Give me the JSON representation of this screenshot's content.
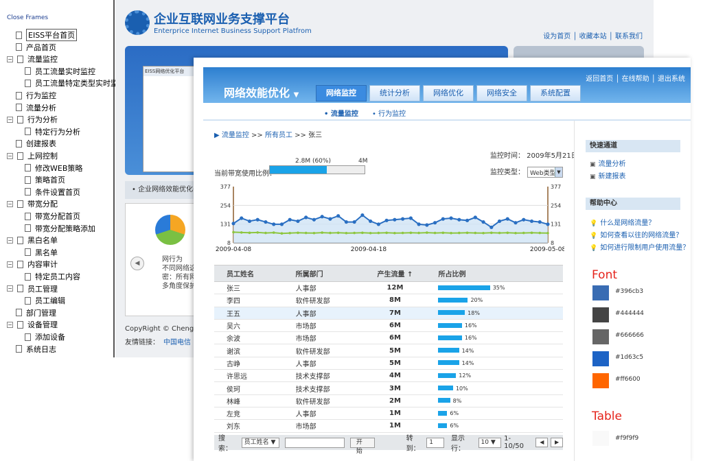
{
  "tree": {
    "close_frames": "Close Frames",
    "items": [
      {
        "label": "EISS平台首页",
        "type": "doc",
        "indent": 1,
        "selected": true
      },
      {
        "label": "产品首页",
        "type": "doc",
        "indent": 1
      },
      {
        "label": "流量监控",
        "type": "folder",
        "indent": 0
      },
      {
        "label": "员工流量实时监控",
        "type": "doc",
        "indent": 2
      },
      {
        "label": "员工流量特定类型实时监",
        "type": "doc",
        "indent": 2
      },
      {
        "label": "行为监控",
        "type": "doc",
        "indent": 1
      },
      {
        "label": "流量分析",
        "type": "doc",
        "indent": 1
      },
      {
        "label": "行为分析",
        "type": "folder",
        "indent": 0
      },
      {
        "label": "特定行为分析",
        "type": "doc",
        "indent": 2
      },
      {
        "label": "创建报表",
        "type": "doc",
        "indent": 1
      },
      {
        "label": "上网控制",
        "type": "folder",
        "indent": 0
      },
      {
        "label": "修改WEB策略",
        "type": "doc",
        "indent": 2
      },
      {
        "label": "策略首页",
        "type": "doc",
        "indent": 2
      },
      {
        "label": "条件设置首页",
        "type": "doc",
        "indent": 2
      },
      {
        "label": "带宽分配",
        "type": "folder",
        "indent": 0
      },
      {
        "label": "带宽分配首页",
        "type": "doc",
        "indent": 2
      },
      {
        "label": "带宽分配策略添加",
        "type": "doc",
        "indent": 2
      },
      {
        "label": "黑白名单",
        "type": "folder",
        "indent": 0
      },
      {
        "label": "黑名单",
        "type": "doc",
        "indent": 2
      },
      {
        "label": "内容审计",
        "type": "folder",
        "indent": 0
      },
      {
        "label": "特定员工内容",
        "type": "doc",
        "indent": 2
      },
      {
        "label": "员工管理",
        "type": "folder",
        "indent": 0
      },
      {
        "label": "员工编辑",
        "type": "doc",
        "indent": 2
      },
      {
        "label": "部门管理",
        "type": "doc",
        "indent": 1
      },
      {
        "label": "设备管理",
        "type": "folder",
        "indent": 0
      },
      {
        "label": "添加设备",
        "type": "doc",
        "indent": 2
      },
      {
        "label": "系统日志",
        "type": "doc",
        "indent": 1
      }
    ]
  },
  "back": {
    "logo_cn": "企业互联网业务支撑平台",
    "logo_en": "Enterprice Internet Business Support Platfrom",
    "toplinks": "设为首页 │ 收藏本站 │ 联系我们",
    "shot_title": "EISS网络优化平台",
    "bar_text": "• 企业网络效能优化平",
    "panel_text": [
      "网行为",
      "不同网络这",
      "密：所有网",
      "多角度保护"
    ],
    "copyright": "CopyRight © Chengdu",
    "links_label": "友情链接：",
    "links_item": "中国电信"
  },
  "front": {
    "title": "网络效能优化",
    "head_links": "返回首页 │ 在线帮助 │ 退出系统",
    "tabs": [
      "网络监控",
      "统计分析",
      "网络优化",
      "网络安全",
      "系统配置"
    ],
    "subnav": [
      "• 流量监控",
      "• 行为监控"
    ],
    "crumb": {
      "a": "▶ 流量监控",
      "sep1": " >> ",
      "b": "所有员工",
      "sep2": " >> ",
      "c": "张三"
    },
    "monitor_time": "监控时间： 2009年5月21日",
    "monitor_type_label": "监控类型：",
    "monitor_type_value": "Web类型",
    "bw_label": "当前带宽使用比例：",
    "bw_used": "2.8M (60%)",
    "bw_total": "4M",
    "bw_fraction": 0.6,
    "table": {
      "headers": [
        "员工姓名",
        "所属部门",
        "产生流量 ↑",
        "所占比例"
      ],
      "rows": [
        [
          "张三",
          "人事部",
          "12M",
          35
        ],
        [
          "李四",
          "软件研发部",
          "8M",
          20
        ],
        [
          "王五",
          "人事部",
          "7M",
          18
        ],
        [
          "吴六",
          "市场部",
          "6M",
          16
        ],
        [
          "余波",
          "市场部",
          "6M",
          16
        ],
        [
          "谢滨",
          "软件研发部",
          "5M",
          14
        ],
        [
          "古峥",
          "人事部",
          "5M",
          14
        ],
        [
          "许思远",
          "技术支撑部",
          "4M",
          12
        ],
        [
          "侯珂",
          "技术支撑部",
          "3M",
          10
        ],
        [
          "林峰",
          "软件研发部",
          "2M",
          8
        ],
        [
          "左竞",
          "人事部",
          "1M",
          6
        ],
        [
          "刘东",
          "市场部",
          "1M",
          6
        ]
      ],
      "highlight_row": 2
    },
    "pager": {
      "search_label": "搜索：",
      "search_field": "员工姓名",
      "search_btn": "开始",
      "goto_label": "转到：",
      "goto_value": "1",
      "rows_label": "显示行：",
      "rows_value": "10",
      "range": "1-10/50"
    },
    "side": {
      "quick_title": "快速通道",
      "quick_items": [
        "流量分析",
        "新建报表"
      ],
      "help_title": "帮助中心",
      "help_items": [
        "什么是网络流量？",
        "如何查看以往的网络流量？",
        "如何进行限制用户使用流量？"
      ]
    }
  },
  "palette": {
    "font_label": "Font",
    "table_label": "Table",
    "font_colors": [
      "#396cb3",
      "#444444",
      "#666666",
      "#1d63c5",
      "#ff6600"
    ],
    "table_colors": [
      "#f9f9f9"
    ]
  },
  "chart_data": {
    "type": "area",
    "x_ticks": [
      "2009-04-08",
      "2009-04-18",
      "2009-05-08"
    ],
    "ylim": [
      8,
      377
    ],
    "y_ticks": [
      8,
      131,
      254,
      377
    ],
    "series": [
      {
        "color": "#2a6fc2",
        "values": [
          135,
          170,
          150,
          160,
          145,
          130,
          130,
          160,
          150,
          175,
          160,
          180,
          165,
          185,
          145,
          145,
          190,
          150,
          130,
          155,
          160,
          165,
          170,
          130,
          125,
          140,
          165,
          170,
          160,
          155,
          175,
          145,
          110,
          150,
          165,
          140,
          160,
          150,
          145,
          130
        ]
      },
      {
        "color": "#8dc63f",
        "values": [
          78,
          76,
          74,
          76,
          73,
          75,
          70,
          72,
          74,
          73,
          72,
          75,
          73,
          74,
          72,
          73,
          74,
          72,
          73,
          74,
          72,
          73,
          74,
          73,
          75,
          73,
          74,
          72,
          73,
          74,
          73,
          72,
          74,
          73,
          74,
          72,
          73,
          74,
          73,
          72
        ]
      }
    ]
  }
}
